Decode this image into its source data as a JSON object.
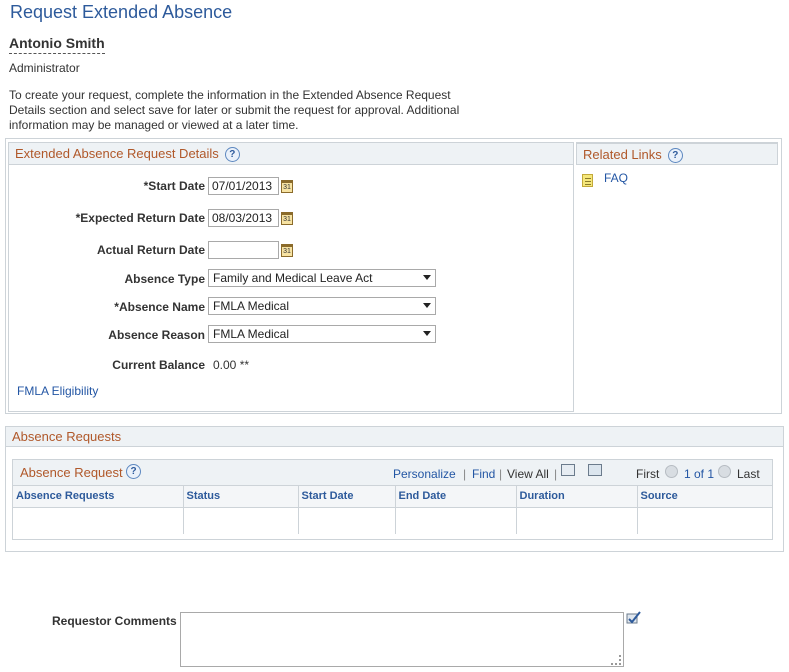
{
  "page": {
    "title": "Request Extended Absence",
    "employee_name": "Antonio Smith",
    "employee_title": "Administrator",
    "instructions": "To create your request, complete the information in the Extended Absence Request Details section and select save for later or submit the request for approval. Additional information may be managed or viewed at a later time."
  },
  "details": {
    "header": "Extended Absence Request Details",
    "help_icon": "?",
    "fields": {
      "start_date": {
        "label": "*Start Date",
        "value": "07/01/2013"
      },
      "expected_return": {
        "label": "*Expected Return Date",
        "value": "08/03/2013"
      },
      "actual_return": {
        "label": "Actual Return Date",
        "value": ""
      },
      "absence_type": {
        "label": "Absence Type",
        "value": "Family and Medical Leave Act"
      },
      "absence_name": {
        "label": "*Absence Name",
        "value": "FMLA Medical"
      },
      "absence_reason": {
        "label": "Absence Reason",
        "value": "FMLA Medical"
      },
      "current_balance": {
        "label": "Current Balance",
        "value": "0.00 **"
      }
    },
    "calendar_glyph": "31",
    "fmla_link": "FMLA Eligibility"
  },
  "related": {
    "header": "Related Links",
    "help_icon": "?",
    "faq": "FAQ"
  },
  "absence_requests": {
    "header": "Absence Requests",
    "grid_title": "Absence Request",
    "help_icon": "?",
    "toolbar": {
      "personalize": "Personalize",
      "sep1": "|",
      "find": "Find",
      "sep2": "|",
      "view_all": "View All",
      "sep3": "|",
      "first": "First",
      "range": "1 of 1",
      "last": "Last"
    },
    "columns": [
      "Absence Requests",
      "Status",
      "Start Date",
      "End Date",
      "Duration",
      "Source"
    ]
  },
  "comments": {
    "label": "Requestor Comments",
    "value": ""
  },
  "icons": {
    "calendar": "calendar-icon",
    "help": "help-icon",
    "faq": "document-icon",
    "zoom": "zoom-icon",
    "download": "spreadsheet-icon",
    "prev": "previous-arrow-icon",
    "next": "next-arrow-icon",
    "spellcheck": "spellcheck-icon"
  },
  "colors": {
    "title": "#2d5a9b",
    "section_header": "#b0582a",
    "link": "#2356a4"
  }
}
